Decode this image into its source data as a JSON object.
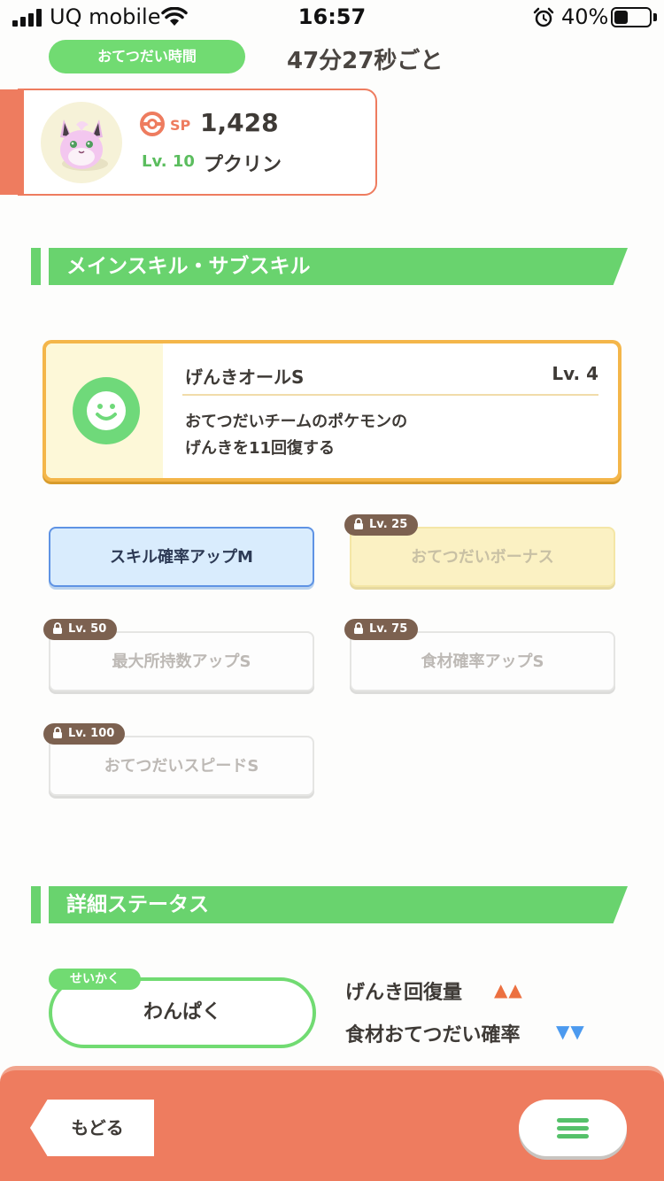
{
  "status_bar": {
    "carrier": "UQ mobile",
    "time": "16:57",
    "battery_percent": "40%",
    "battery_level": 0.4
  },
  "help": {
    "label": "おてつだい時間",
    "value": "47分27秒ごと"
  },
  "pokemon": {
    "sp_label": "SP",
    "sp_value": "1,428",
    "level_label": "Lv. 10",
    "name": "プクリン",
    "accent_color": "#ee7c5f"
  },
  "skills_section": {
    "title": "メインスキル・サブスキル"
  },
  "main_skill": {
    "name": "げんきオールS",
    "level": "Lv. 4",
    "description_line1": "おてつだいチームのポケモンの",
    "description_line2": "げんきを11回復する",
    "icon": "smiley-face-icon"
  },
  "sub_skills": [
    {
      "label": "スキル確率アップM",
      "state": "active",
      "unlock_level": ""
    },
    {
      "label": "おてつだいボーナス",
      "state": "locked",
      "unlock_level": "Lv. 25"
    },
    {
      "label": "最大所持数アップS",
      "state": "locked",
      "unlock_level": "Lv. 50"
    },
    {
      "label": "食材確率アップS",
      "state": "locked",
      "unlock_level": "Lv. 75"
    },
    {
      "label": "おてつだいスピードS",
      "state": "locked",
      "unlock_level": "Lv. 100"
    }
  ],
  "details_section": {
    "title": "詳細ステータス"
  },
  "nature": {
    "tag": "せいかく",
    "name": "わんぱく",
    "up_stat": "げんき回復量",
    "up_marker": "▲▲",
    "down_stat": "食材おてつだい確率",
    "down_marker": "▼▼",
    "up_color": "#ec7040",
    "down_color": "#4c9aef"
  },
  "nav": {
    "back_label": "もどる",
    "menu_icon": "hamburger-menu-icon"
  }
}
